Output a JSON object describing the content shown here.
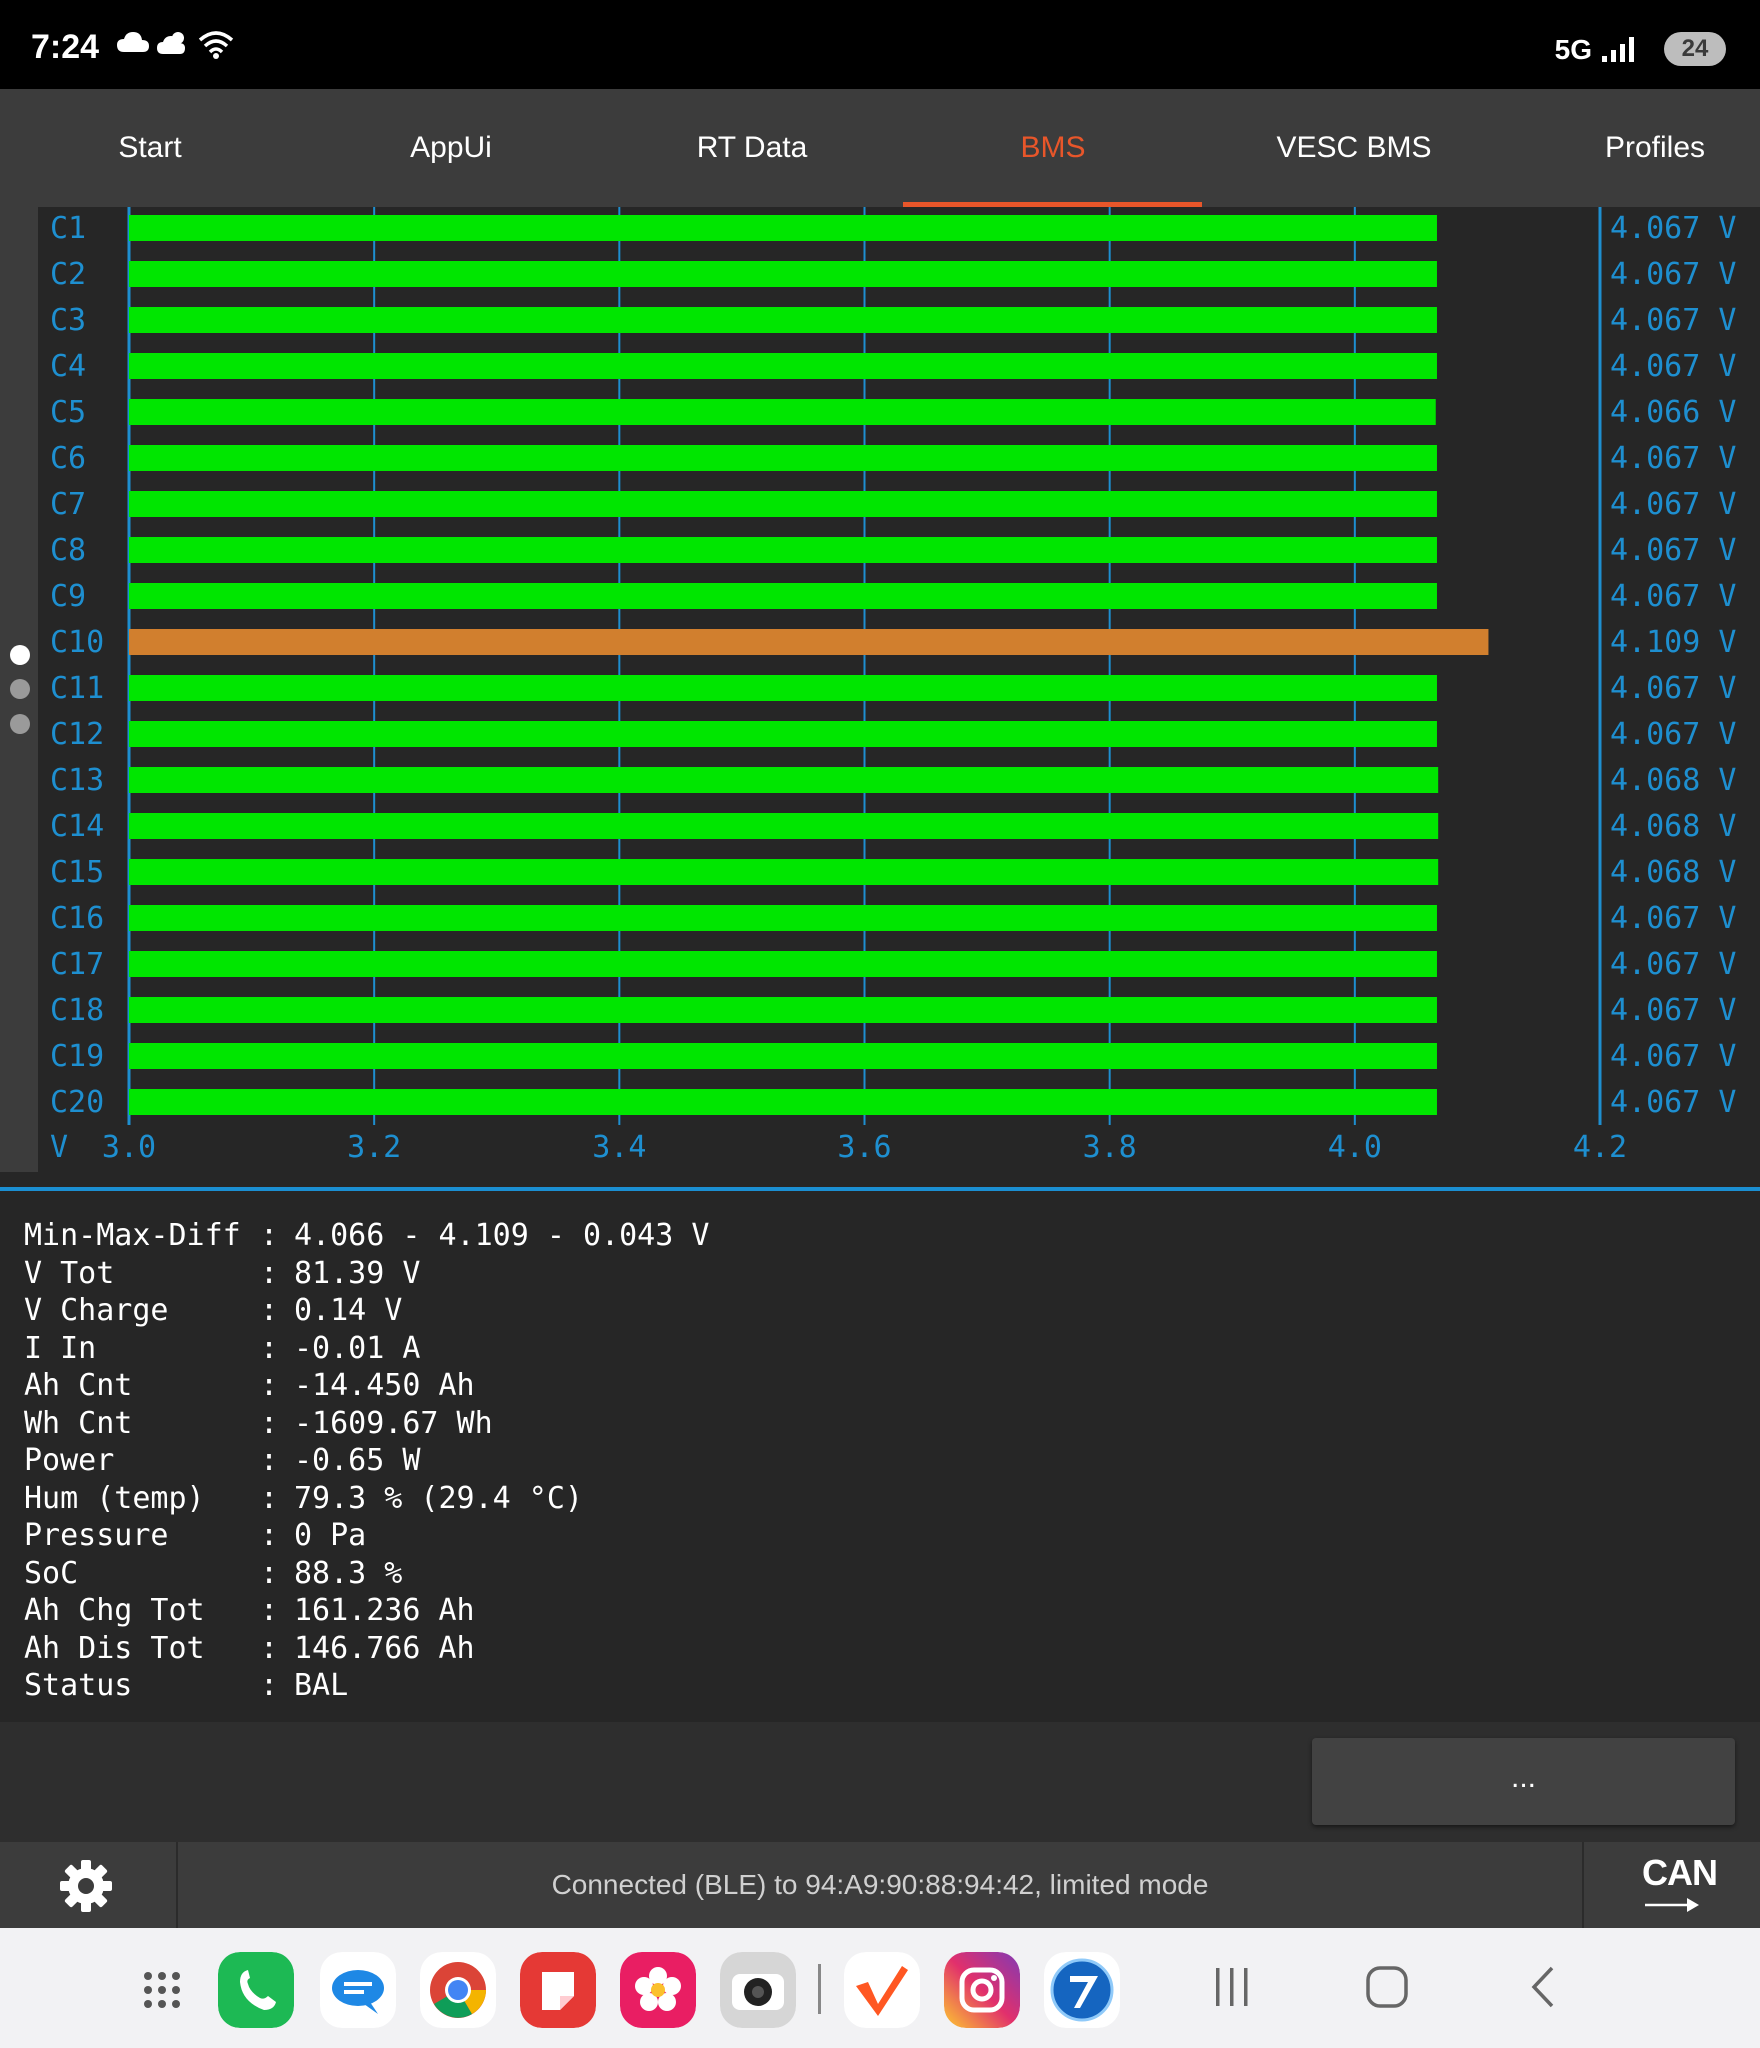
{
  "status_bar": {
    "time": "7:24",
    "network": "5G",
    "battery": "24"
  },
  "tabs": [
    {
      "label": "Start"
    },
    {
      "label": "AppUi"
    },
    {
      "label": "RT Data"
    },
    {
      "label": "BMS",
      "active": true
    },
    {
      "label": "VESC BMS"
    },
    {
      "label": "Profiles"
    }
  ],
  "chart_data": {
    "type": "bar",
    "orientation": "horizontal",
    "categories": [
      "C1",
      "C2",
      "C3",
      "C4",
      "C5",
      "C6",
      "C7",
      "C8",
      "C9",
      "C10",
      "C11",
      "C12",
      "C13",
      "C14",
      "C15",
      "C16",
      "C17",
      "C18",
      "C19",
      "C20"
    ],
    "values": [
      4.067,
      4.067,
      4.067,
      4.067,
      4.066,
      4.067,
      4.067,
      4.067,
      4.067,
      4.109,
      4.067,
      4.067,
      4.068,
      4.068,
      4.068,
      4.067,
      4.067,
      4.067,
      4.067,
      4.067
    ],
    "value_labels": [
      "4.067 V",
      "4.067 V",
      "4.067 V",
      "4.067 V",
      "4.066 V",
      "4.067 V",
      "4.067 V",
      "4.067 V",
      "4.067 V",
      "4.109 V",
      "4.067 V",
      "4.067 V",
      "4.068 V",
      "4.068 V",
      "4.068 V",
      "4.067 V",
      "4.067 V",
      "4.067 V",
      "4.067 V",
      "4.067 V"
    ],
    "xlabel": "V",
    "xlim": [
      3.0,
      4.2
    ],
    "xticks": [
      "3.0",
      "3.2",
      "3.4",
      "3.6",
      "3.8",
      "4.0",
      "4.2"
    ],
    "grid": true,
    "colors": {
      "normal": "#00e600",
      "highlight": "#d17f2e",
      "axis": "#1e8fd0",
      "text": "#1e8fd0"
    },
    "highlighted_cell": "C10"
  },
  "page_dots": {
    "count": 3,
    "active": 0
  },
  "info": [
    {
      "label": "Min-Max-Diff",
      "value": "4.066 - 4.109 - 0.043 V"
    },
    {
      "label": "V Tot",
      "value": "81.39 V"
    },
    {
      "label": "V Charge",
      "value": "0.14 V"
    },
    {
      "label": "I In",
      "value": "-0.01 A"
    },
    {
      "label": "Ah Cnt",
      "value": "-14.450 Ah"
    },
    {
      "label": "Wh Cnt",
      "value": "-1609.67 Wh"
    },
    {
      "label": "Power",
      "value": "-0.65 W"
    },
    {
      "label": "Hum (temp)",
      "value": "79.3 % (29.4 °C)"
    },
    {
      "label": "Pressure",
      "value": "0 Pa"
    },
    {
      "label": "SoC",
      "value": "88.3 %"
    },
    {
      "label": "Ah Chg Tot",
      "value": "161.236 Ah"
    },
    {
      "label": "Ah Dis Tot",
      "value": "146.766 Ah"
    },
    {
      "label": "Status",
      "value": "BAL"
    }
  ],
  "separator": ":",
  "more_button": {
    "label": "..."
  },
  "connection": {
    "text": "Connected (BLE) to 94:A9:90:88:94:42, limited mode",
    "can_label": "CAN"
  },
  "dock_apps": [
    "app-drawer-icon",
    "phone-app-icon",
    "messages-app-icon",
    "chrome-app-icon",
    "notes-app-icon",
    "gallery-app-icon",
    "camera-app-icon",
    "vesc-app-icon",
    "instagram-app-icon",
    "browser-app-icon"
  ],
  "accent": "#e8562a"
}
